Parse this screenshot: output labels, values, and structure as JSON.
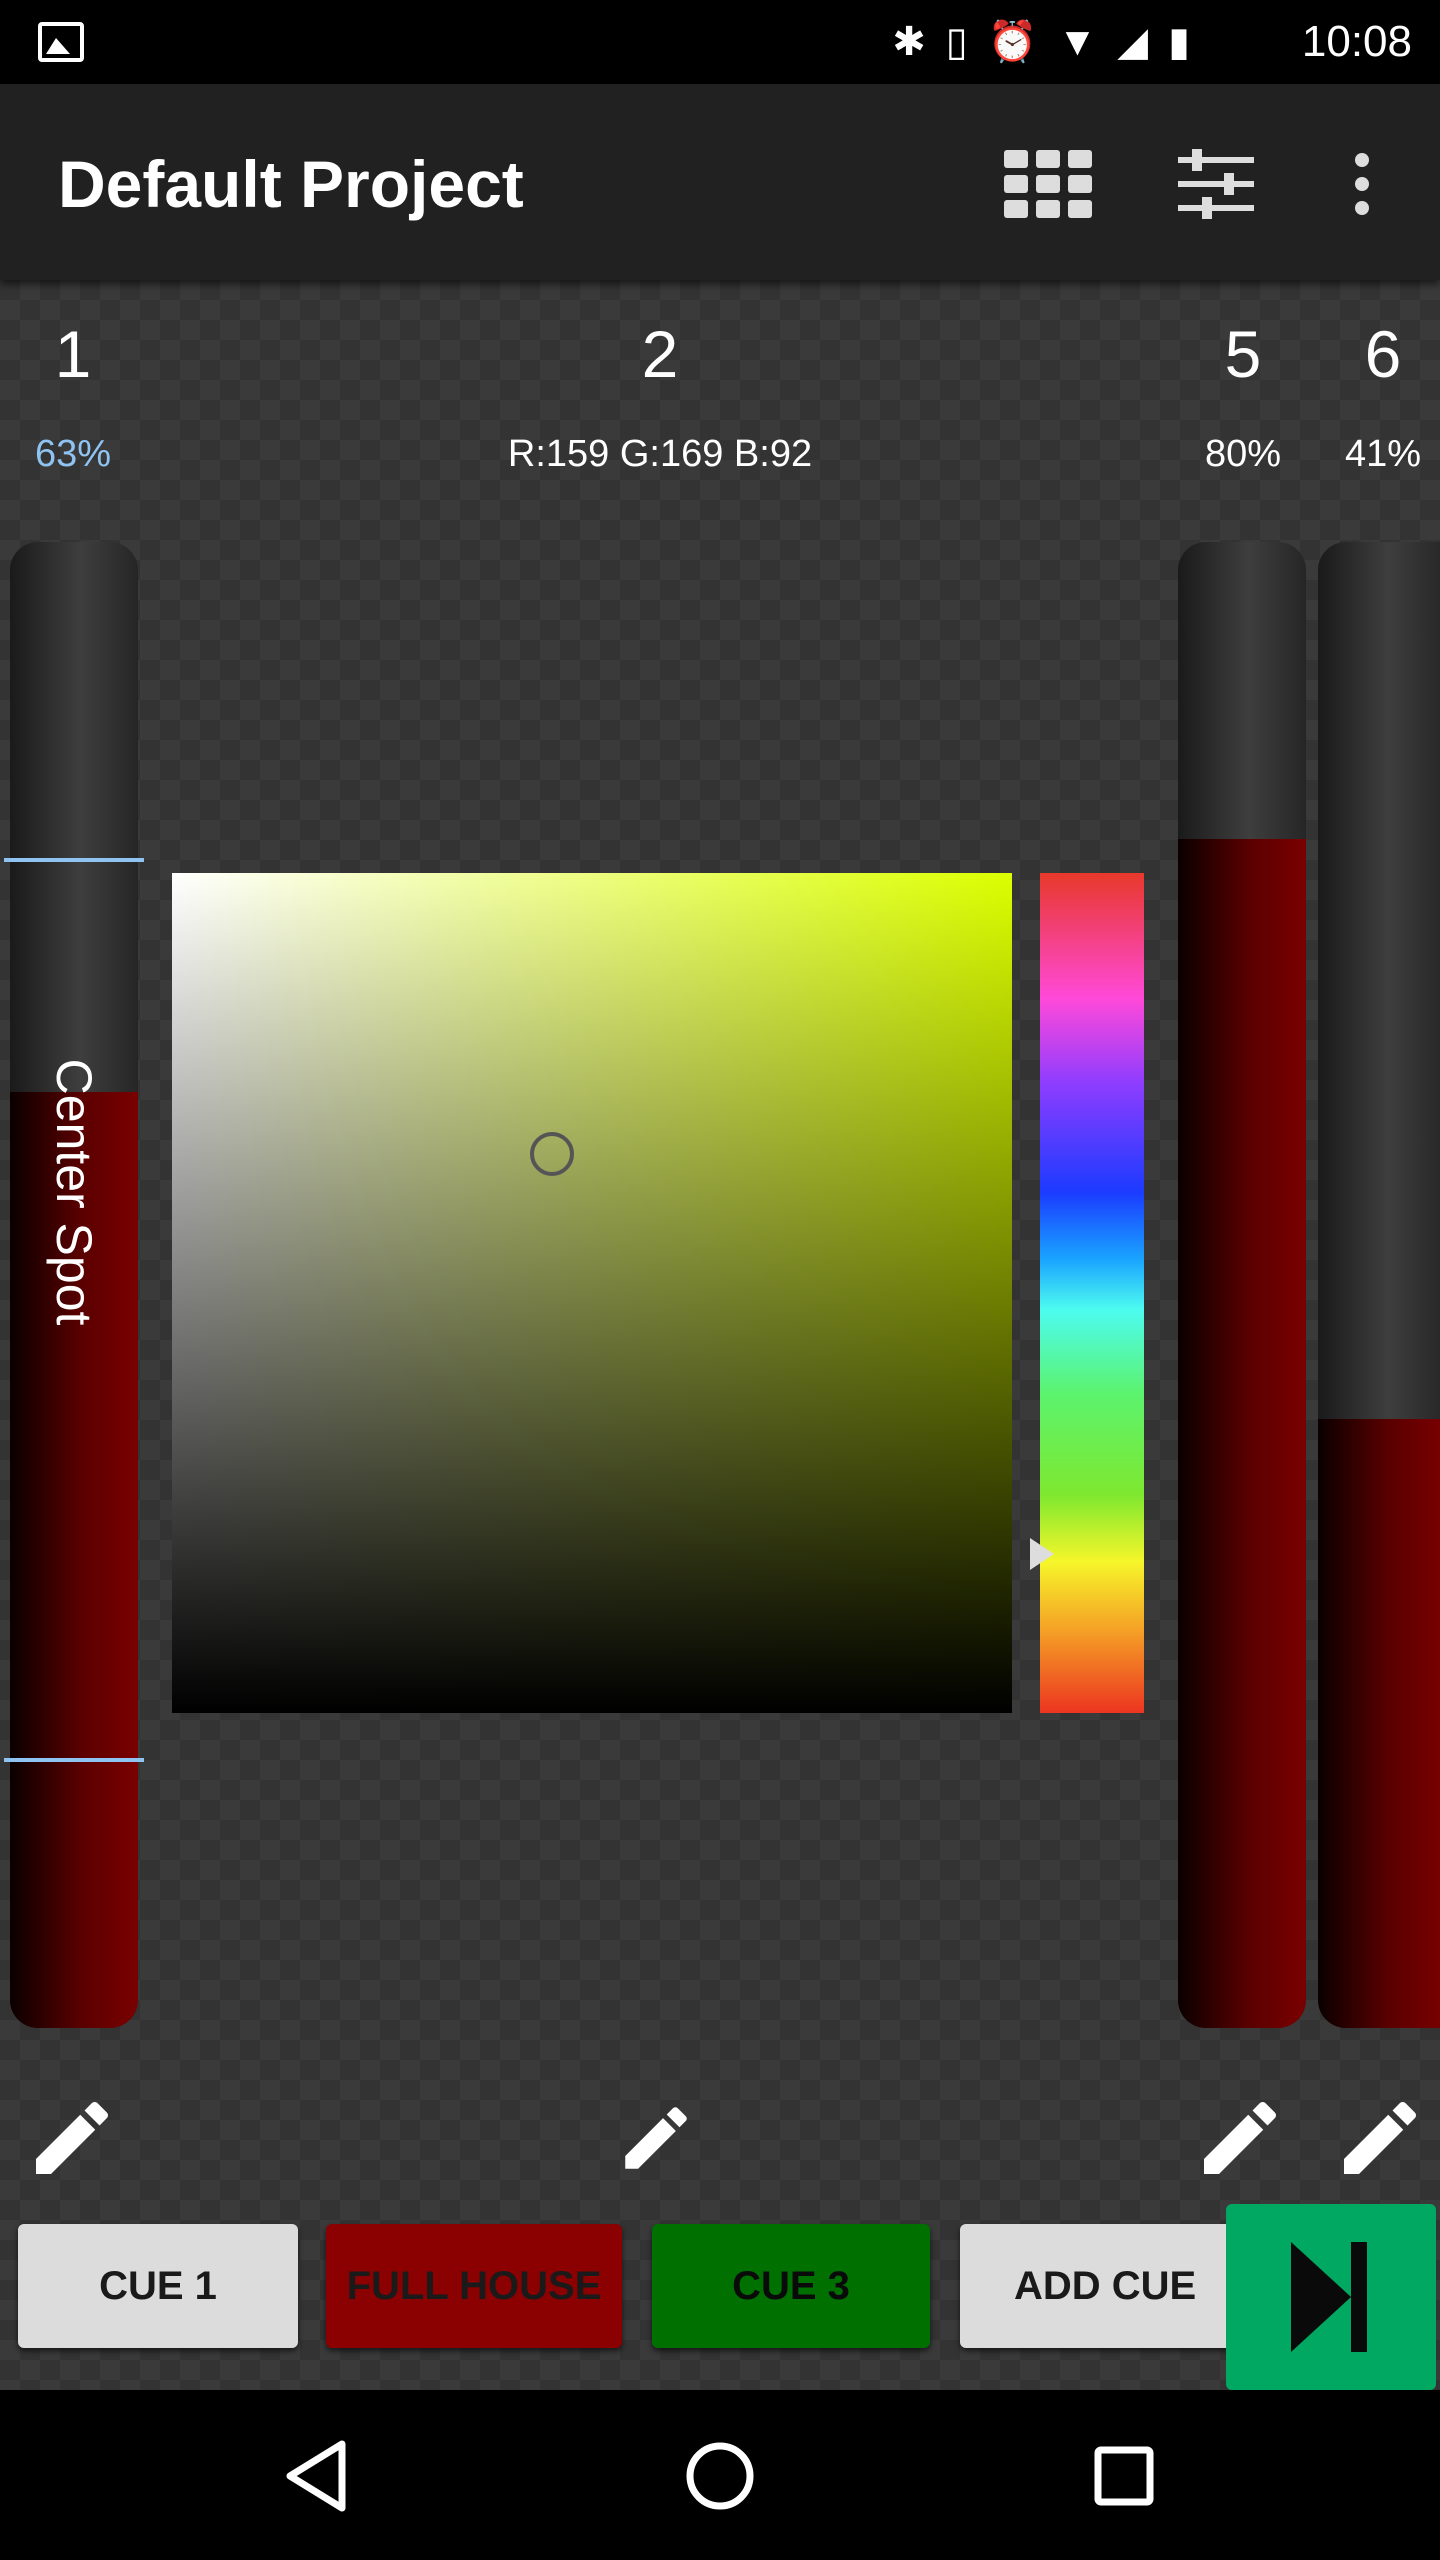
{
  "status_bar": {
    "time": "10:08",
    "icons": [
      "image-icon",
      "bluetooth-icon",
      "vibrate-icon",
      "alarm-icon",
      "wifi-icon",
      "signal-icon",
      "battery-icon"
    ]
  },
  "app_bar": {
    "title": "Default Project",
    "actions": [
      "grid-icon",
      "sliders-icon",
      "more-vert-icon"
    ]
  },
  "channels": [
    {
      "number": "1",
      "value": "63%",
      "label": "Center Spot",
      "level": 0.63
    },
    {
      "number": "2",
      "value": "R:159 G:169 B:92"
    },
    {
      "number": "5",
      "value": "80%",
      "level": 0.8
    },
    {
      "number": "6",
      "value": "41%",
      "level": 0.41
    }
  ],
  "color_picker": {
    "hue_color": "#dcff00",
    "selected_rgb": "R:159 G:169 B:92"
  },
  "cues": [
    {
      "label": "CUE 1",
      "color": "#dcdcdc"
    },
    {
      "label": "FULL HOUSE",
      "color": "#8b0000"
    },
    {
      "label": "CUE 3",
      "color": "#007000"
    },
    {
      "label": "ADD CUE",
      "color": "#dcdcdc"
    }
  ],
  "go_button": {
    "icon": "skip-next-icon",
    "color": "#00a862"
  },
  "nav_bar": [
    "back-icon",
    "home-icon",
    "recents-icon"
  ]
}
